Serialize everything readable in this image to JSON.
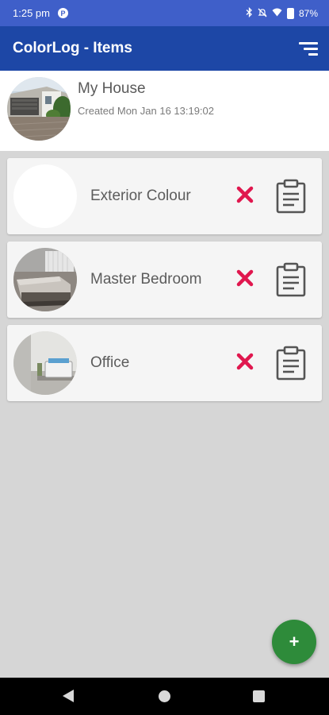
{
  "status_bar": {
    "time": "1:25 pm",
    "app_icon_letter": "P",
    "battery": "87%"
  },
  "app_bar": {
    "title": "ColorLog - Items",
    "sort_icon": "sort-icon"
  },
  "house": {
    "name": "My House",
    "created": "Created Mon Jan 16 13:19:02"
  },
  "items": [
    {
      "name": "Exterior Colour",
      "thumbnail": "blank"
    },
    {
      "name": "Master Bedroom",
      "thumbnail": "bedroom-photo"
    },
    {
      "name": "Office",
      "thumbnail": "office-photo"
    }
  ],
  "fab": {
    "label": "+"
  },
  "colors": {
    "status_bar": "#3f5fc9",
    "app_bar": "#1d47a6",
    "delete": "#e0174e",
    "fab": "#2e8b3a",
    "background": "#d6d6d6"
  }
}
